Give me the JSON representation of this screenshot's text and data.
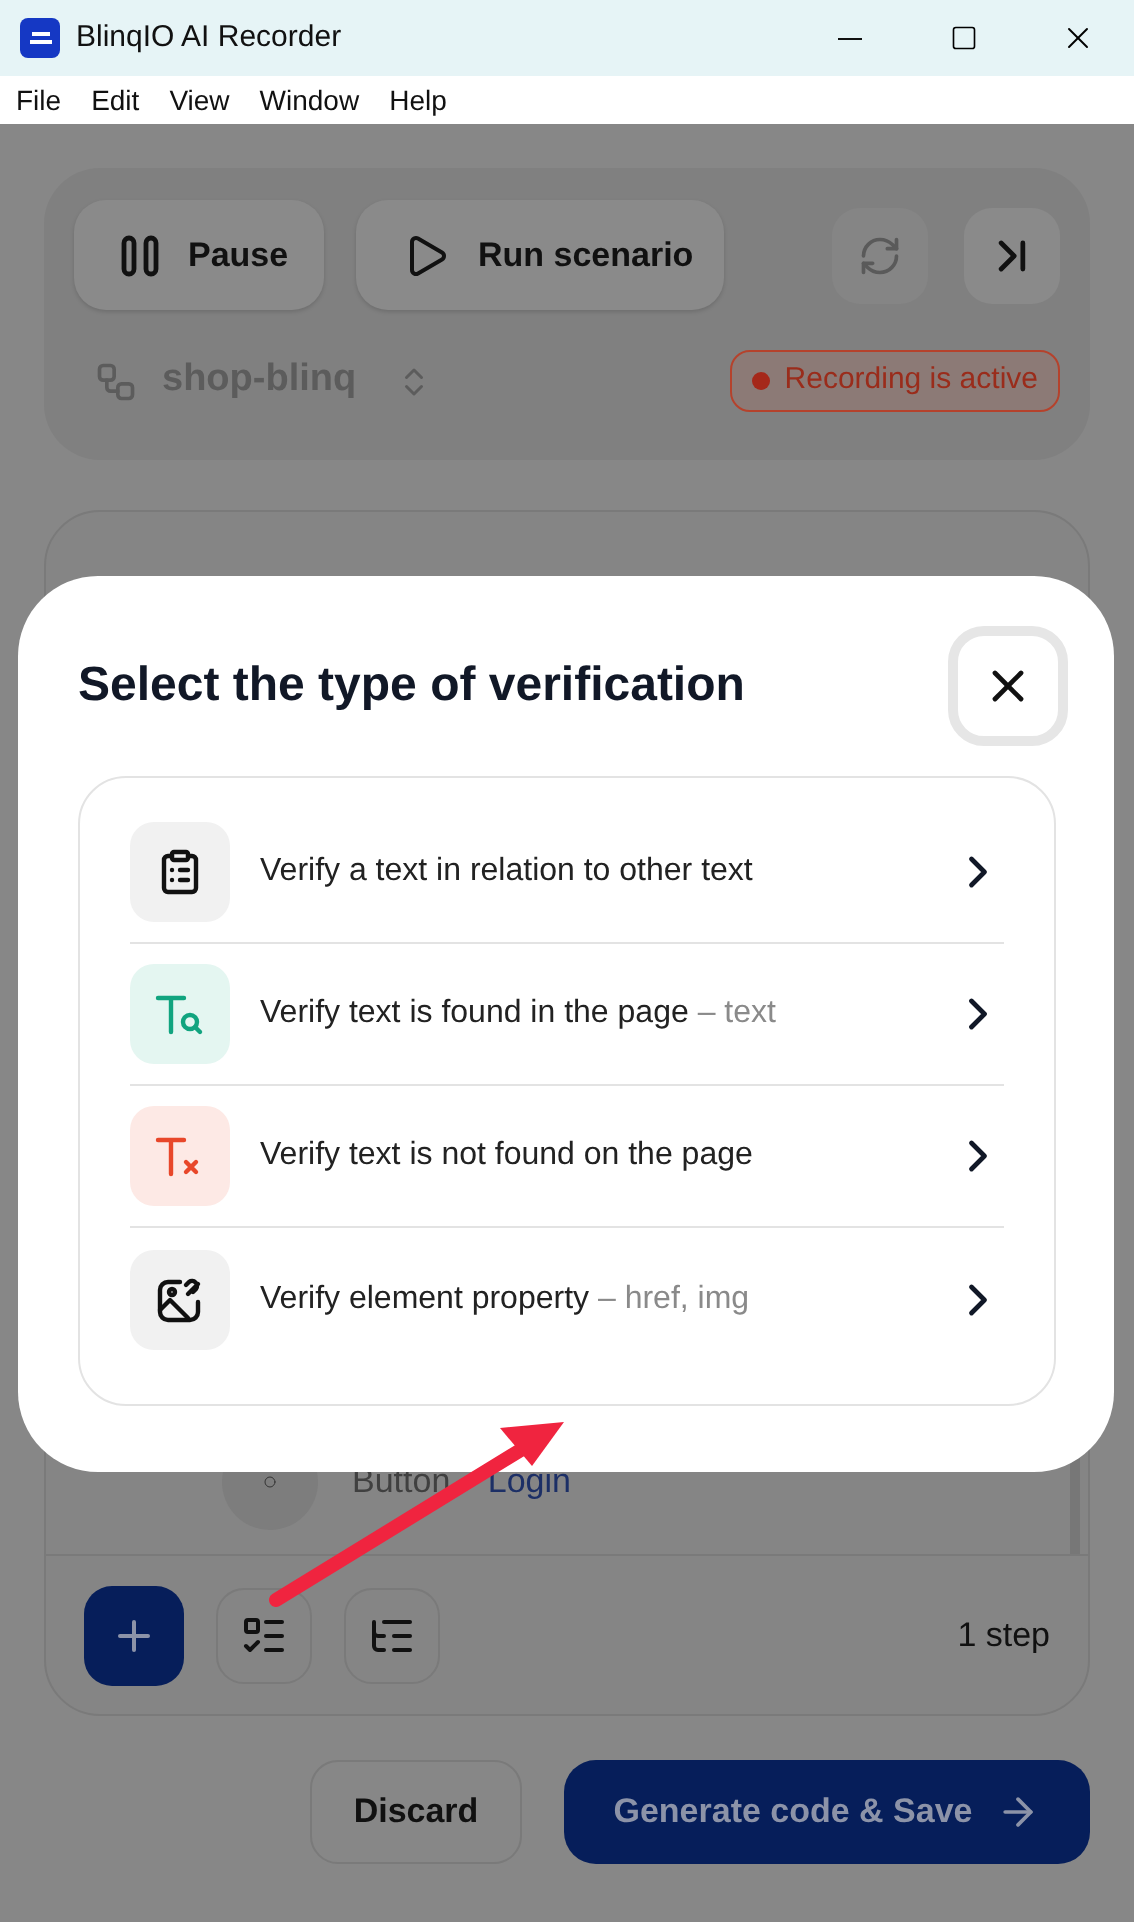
{
  "window": {
    "title": "BlinqIO AI Recorder"
  },
  "menu": [
    "File",
    "Edit",
    "View",
    "Window",
    "Help"
  ],
  "controls": [
    {
      "kind": "pause",
      "label": "Pause"
    },
    {
      "kind": "run",
      "label": "Run scenario"
    }
  ],
  "project": {
    "name": "shop-blinq"
  },
  "status": {
    "label": "Recording is active"
  },
  "steps": [
    {
      "element": "Button",
      "target": "Login"
    }
  ],
  "step_count": "1 step",
  "footer": {
    "discard": "Discard",
    "save": "Generate code & Save"
  },
  "dialog": {
    "title": "Select the type of verification",
    "options": [
      {
        "kind": "relation",
        "label": "Verify a text in relation to other text"
      },
      {
        "kind": "found",
        "label": "Verify text is found in the page",
        "hint": "– text"
      },
      {
        "kind": "not_found",
        "label": "Verify text is not found on the page"
      },
      {
        "kind": "property",
        "label": "Verify element property",
        "hint": "– href, img"
      }
    ]
  }
}
